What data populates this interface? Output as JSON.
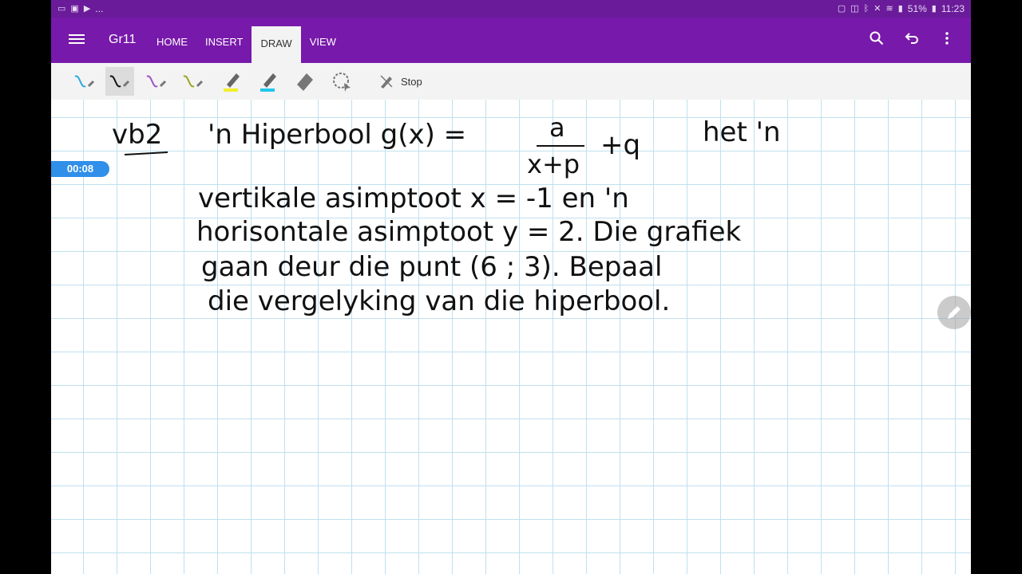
{
  "status_bar": {
    "left_more": "...",
    "battery": "51%",
    "time": "11:23"
  },
  "app": {
    "title": "Gr11",
    "tabs": [
      {
        "label": "HOME"
      },
      {
        "label": "INSERT"
      },
      {
        "label": "DRAW",
        "active": true
      },
      {
        "label": "VIEW"
      }
    ]
  },
  "ribbon": {
    "tools": [
      {
        "name": "pen-blue",
        "color": "#29a8e0"
      },
      {
        "name": "pen-black",
        "color": "#111111",
        "selected": true
      },
      {
        "name": "pen-purple",
        "color": "#9b51c6"
      },
      {
        "name": "pen-olive",
        "color": "#9aa321"
      },
      {
        "name": "highlighter-yellow",
        "color": "#f2ee2b"
      },
      {
        "name": "highlighter-cyan",
        "color": "#21c8ec"
      },
      {
        "name": "eraser",
        "color": "#666666"
      },
      {
        "name": "lasso-select",
        "color": "#666666"
      }
    ],
    "stop_label": "Stop"
  },
  "recording": {
    "timer": "00:08"
  },
  "handwriting": {
    "line1_label": "vb2",
    "line1": "'n Hiperbool g(x) =",
    "fraction_num": "a",
    "fraction_den": "x+p",
    "line1_plus": "+q",
    "line1_end": "het 'n",
    "line2": "vertikale asimptoot x = -1 en 'n",
    "line3": "horisontale asimptoot y = 2. Die grafiek",
    "line4": "gaan deur die punt (6 ; 3). Bepaal",
    "line5": "die vergelyking van die hiperbool."
  },
  "colors": {
    "app_bar": "#7719aa",
    "status_bar": "#6a1b9a",
    "grid": "#bfe0f0",
    "timer": "#2f8fe9"
  }
}
